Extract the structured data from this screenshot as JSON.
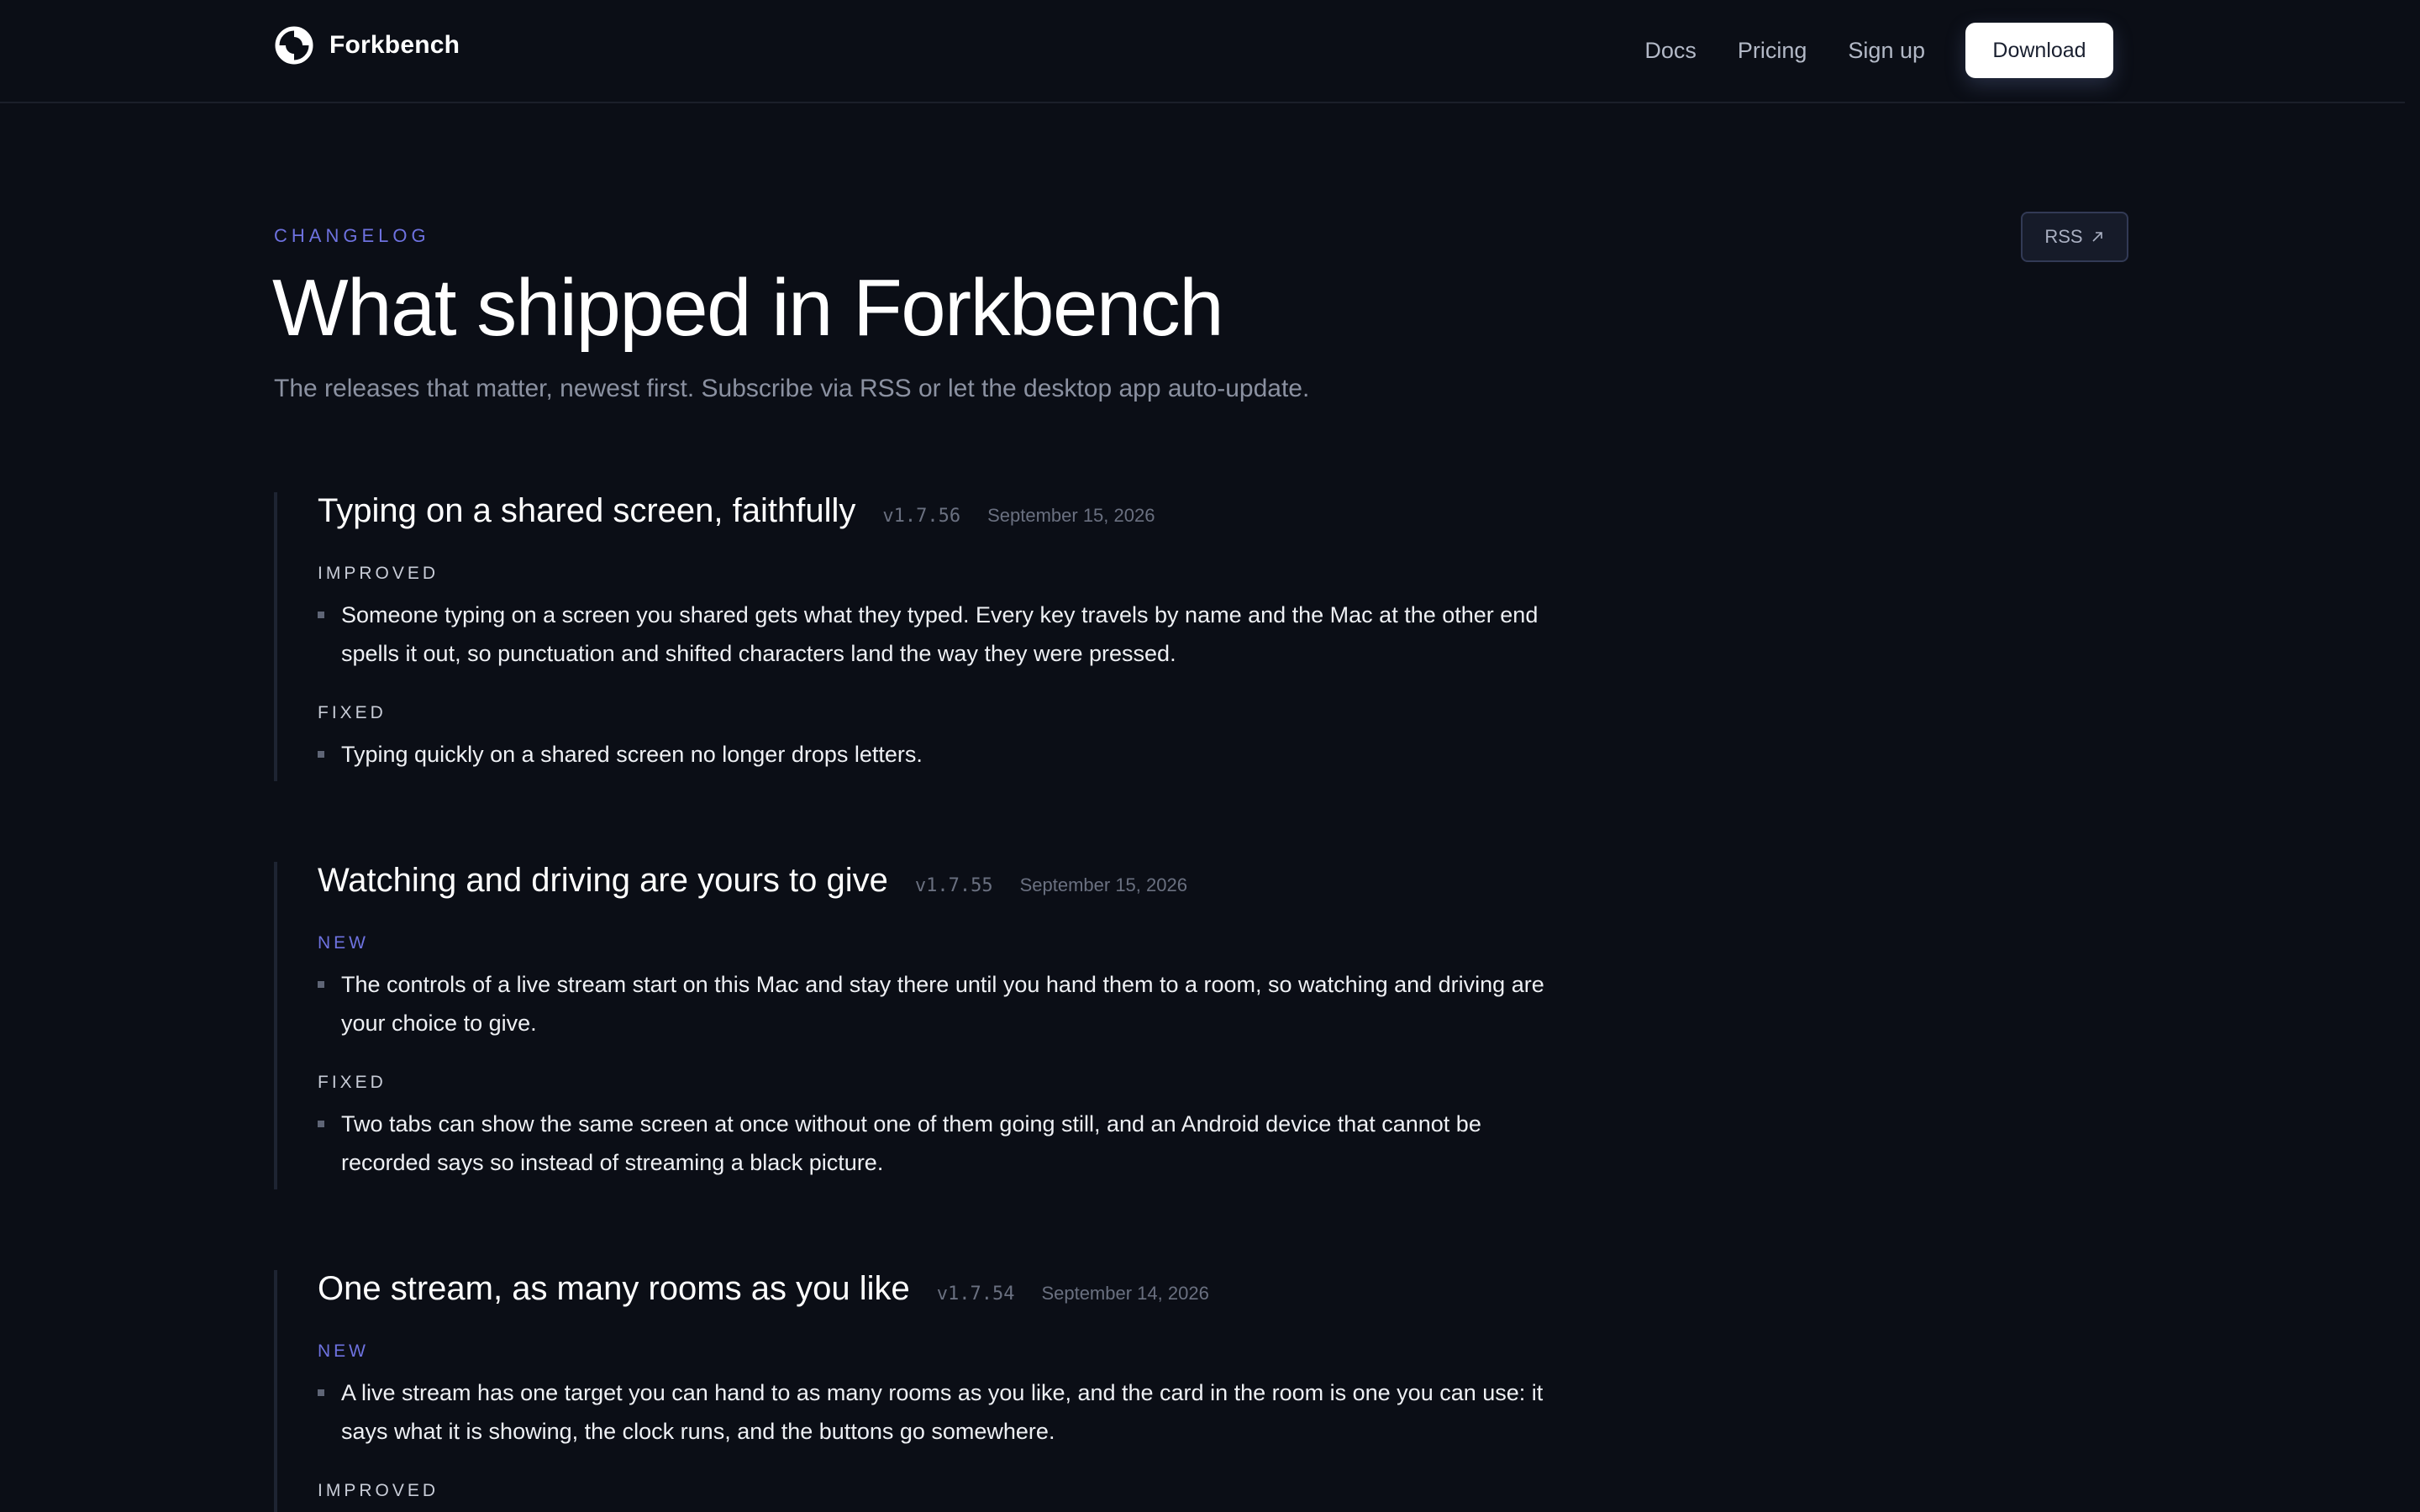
{
  "header": {
    "brand_name": "Forkbench",
    "nav": [
      "Docs",
      "Pricing",
      "Sign up"
    ],
    "download_label": "Download"
  },
  "hero": {
    "eyebrow": "CHANGELOG",
    "title": "What shipped in Forkbench",
    "subtitle": "The releases that matter, newest first. Subscribe via RSS or let the desktop app auto-update.",
    "rss_label": "RSS",
    "rss_icon": "arrow-up-right-icon"
  },
  "colors": {
    "background": "#0b0e16",
    "accent": "#6e72e0",
    "text": "#eef0f4",
    "muted": "#6a7080"
  },
  "releases": [
    {
      "title": "Typing on a shared screen, faithfully",
      "version": "v1.7.56",
      "date": "September 15, 2026",
      "sections": [
        {
          "label": "IMPROVED",
          "items": [
            "Someone typing on a screen you shared gets what they typed. Every key travels by name and the Mac at the other end spells it out, so punctuation and shifted characters land the way they were pressed."
          ]
        },
        {
          "label": "FIXED",
          "items": [
            "Typing quickly on a shared screen no longer drops letters."
          ]
        }
      ]
    },
    {
      "title": "Watching and driving are yours to give",
      "version": "v1.7.55",
      "date": "September 15, 2026",
      "sections": [
        {
          "label": "NEW",
          "items": [
            "The controls of a live stream start on this Mac and stay there until you hand them to a room, so watching and driving are your choice to give."
          ]
        },
        {
          "label": "FIXED",
          "items": [
            "Two tabs can show the same screen at once without one of them going still, and an Android device that cannot be recorded says so instead of streaming a black picture."
          ]
        }
      ]
    },
    {
      "title": "One stream, as many rooms as you like",
      "version": "v1.7.54",
      "date": "September 14, 2026",
      "sections": [
        {
          "label": "NEW",
          "items": [
            "A live stream has one target you can hand to as many rooms as you like, and the card in the room is one you can use: it says what it is showing, the clock runs, and the buttons go somewhere."
          ]
        },
        {
          "label": "IMPROVED",
          "items": []
        }
      ]
    }
  ]
}
